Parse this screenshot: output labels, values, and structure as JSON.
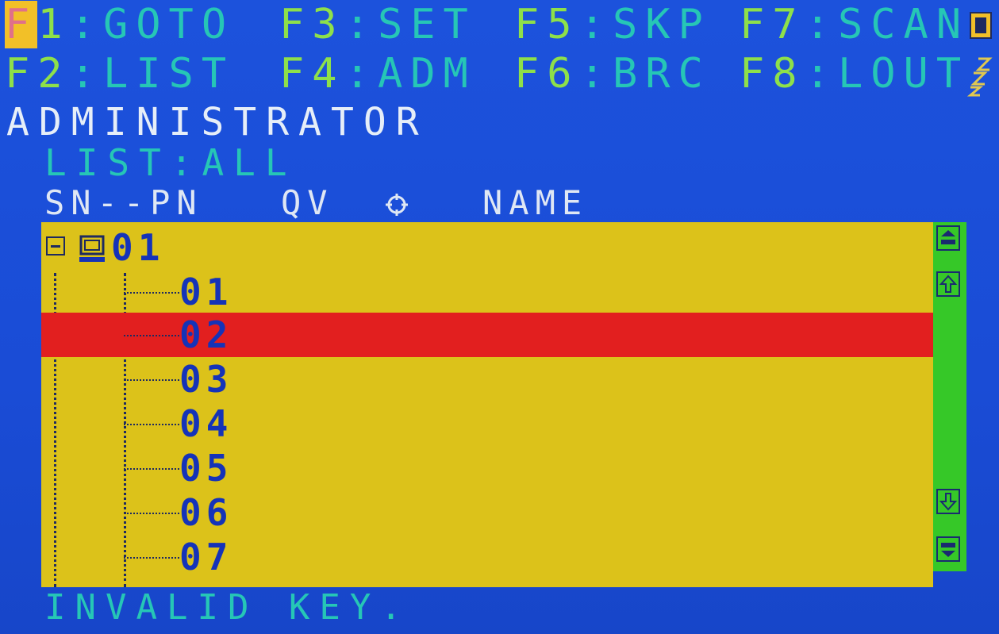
{
  "hotkeys": {
    "f1": {
      "key": "F1",
      "sep": ":",
      "label": "GOTO"
    },
    "f3": {
      "key": "F3",
      "sep": ":",
      "label": "SET"
    },
    "f5": {
      "key": "F5",
      "sep": ":",
      "label": "SKP"
    },
    "f7": {
      "key": "F7",
      "sep": ":",
      "label": "SCAN"
    },
    "f2": {
      "key": "F2",
      "sep": ":",
      "label": "LIST"
    },
    "f4": {
      "key": "F4",
      "sep": ":",
      "label": "ADM"
    },
    "f6": {
      "key": "F6",
      "sep": ":",
      "label": "BRC"
    },
    "f8": {
      "key": "F8",
      "sep": ":",
      "label": "LOUT"
    }
  },
  "title": "ADMINISTRATOR",
  "list_filter": "LIST:ALL",
  "header": {
    "sn_pn": "SN--PN",
    "qv": "QV",
    "name": "NAME"
  },
  "tree": {
    "node": "01",
    "ports": [
      {
        "label": "01",
        "selected": false
      },
      {
        "label": "02",
        "selected": true
      },
      {
        "label": "03",
        "selected": false
      },
      {
        "label": "04",
        "selected": false
      },
      {
        "label": "05",
        "selected": false
      },
      {
        "label": "06",
        "selected": false
      },
      {
        "label": "07",
        "selected": false
      }
    ]
  },
  "status_message": "INVALID KEY.",
  "colors": {
    "background": "#1a4fd8",
    "list_bg": "#dcc21a",
    "selected_bg": "#e21f1f",
    "scrollbar": "#36c828",
    "hotkey_key": "#8ee04a",
    "hotkey_desc": "#26c6b6"
  }
}
